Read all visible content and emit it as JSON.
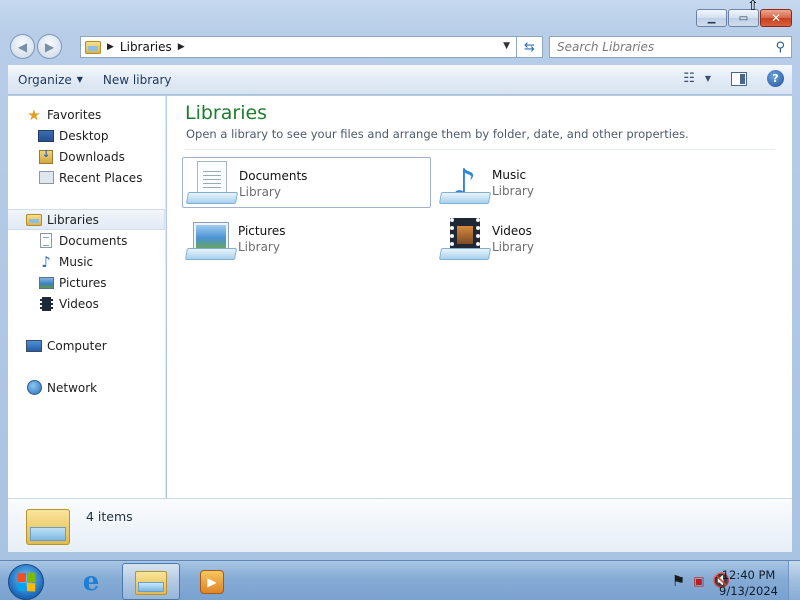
{
  "window": {
    "minimize_glyph": "▁",
    "maximize_glyph": "▭",
    "close_glyph": "✕"
  },
  "address_bar": {
    "breadcrumb": "Libraries",
    "back_glyph": "◀",
    "forward_glyph": "▶"
  },
  "search": {
    "placeholder": "Search Libraries"
  },
  "toolbar": {
    "organize_label": "Organize",
    "new_library_label": "New library"
  },
  "navigation": {
    "favorites_label": "Favorites",
    "favorites_items": [
      "Desktop",
      "Downloads",
      "Recent Places"
    ],
    "libraries_label": "Libraries",
    "libraries_items": [
      "Documents",
      "Music",
      "Pictures",
      "Videos"
    ],
    "computer_label": "Computer",
    "network_label": "Network"
  },
  "content": {
    "title": "Libraries",
    "subtitle": "Open a library to see your files and arrange them by folder, date, and other properties.",
    "libraries": [
      {
        "name": "Documents",
        "type": "Library",
        "icon": "documents-library-icon",
        "selected": true
      },
      {
        "name": "Music",
        "type": "Library",
        "icon": "music-library-icon",
        "selected": false
      },
      {
        "name": "Pictures",
        "type": "Library",
        "icon": "pictures-library-icon",
        "selected": false
      },
      {
        "name": "Videos",
        "type": "Library",
        "icon": "videos-library-icon",
        "selected": false
      }
    ]
  },
  "details": {
    "item_count": "4 items"
  },
  "taskbar": {
    "time": "12:40 PM",
    "date": "9/13/2024",
    "apps": [
      "internet-explorer",
      "windows-explorer",
      "windows-media-player"
    ]
  },
  "colors": {
    "title_green": "#1e7e2e",
    "taskbar_blue": "#86acd5",
    "accent_blue": "#2f6fb8"
  }
}
